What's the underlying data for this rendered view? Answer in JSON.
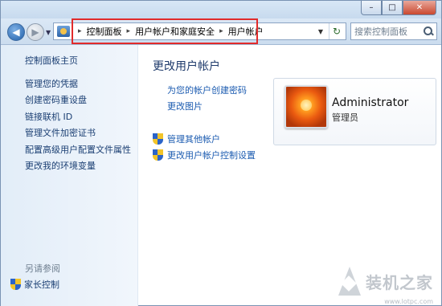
{
  "window": {
    "caption_buttons": {
      "minimize": "–",
      "maximize": "□",
      "close": "✕"
    }
  },
  "nav": {
    "back_icon": "back-arrow-icon",
    "forward_icon": "forward-arrow-icon",
    "breadcrumbs": [
      "控制面板",
      "用户帐户和家庭安全",
      "用户帐户"
    ],
    "separator": "▸",
    "search_placeholder": "搜索控制面板"
  },
  "left_pane": {
    "home": "控制面板主页",
    "links": [
      "管理您的凭据",
      "创建密码重设盘",
      "链接联机 ID",
      "管理文件加密证书",
      "配置高级用户配置文件属性",
      "更改我的环境变量"
    ],
    "see_also": "另请参阅",
    "family_safety": "家长控制"
  },
  "main": {
    "heading": "更改用户帐户",
    "links": [
      "为您的帐户创建密码",
      "更改图片"
    ],
    "admin_links": [
      "管理其他帐户",
      "更改用户帐户控制设置"
    ]
  },
  "user": {
    "name": "Administrator",
    "role": "管理员"
  },
  "watermark": {
    "text": "装机之家",
    "url": "www.lotpc.com"
  },
  "colors": {
    "highlight_box": "#e12b2b",
    "link": "#1b5bb0",
    "heading": "#1e3a6b"
  }
}
